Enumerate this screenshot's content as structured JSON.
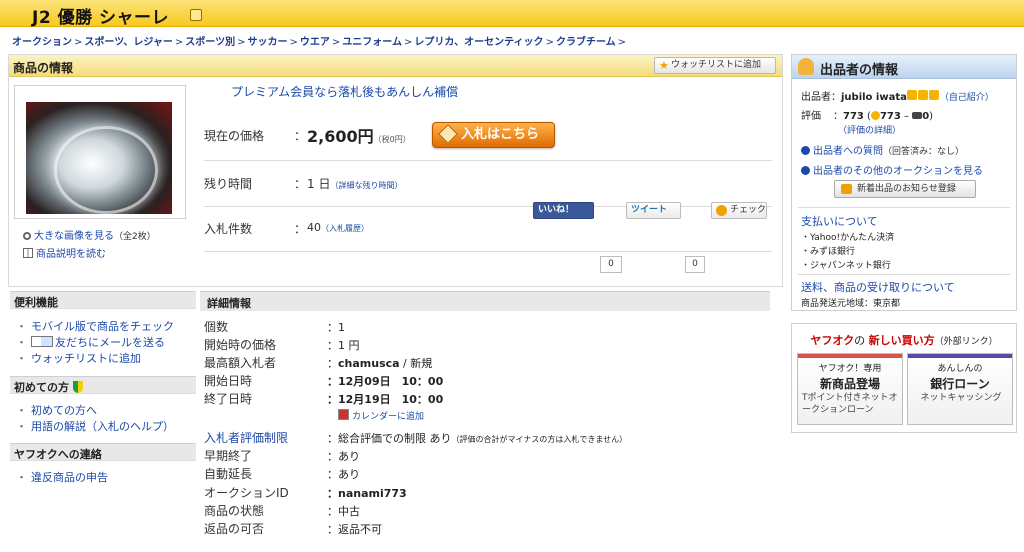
{
  "title_bar": {
    "title": "J2 優勝 シャーレ"
  },
  "breadcrumb": [
    "オークション",
    "スポーツ、レジャー",
    "スポーツ別",
    "サッカー",
    "ウエア",
    "ユニフォーム",
    "レプリカ、オーセンティック",
    "クラブチーム"
  ],
  "breadcrumb_sep": ">",
  "item": {
    "header_title": "商品の情報",
    "watchlist_label": "ウォッチリストに追加",
    "premium_text": "プレミアム会員なら落札後もあんしん補償",
    "price_label": "現在の価格",
    "price_value": "2,600円",
    "price_tax": "（税0円）",
    "bid_button": "入札はこちら",
    "time_label": "残り時間",
    "time_value": "1 日",
    "time_detail": "（詳細な残り時間）",
    "bids_label": "入札件数",
    "bids_value": "40",
    "bids_history": "（入札履歴）",
    "enlarge_link": "大きな画像を見る",
    "enlarge_count": "（全2枚）",
    "description_link": "商品説明を読む",
    "colon": "："
  },
  "social": {
    "like_label": "いいね！",
    "like_count": "0",
    "tweet_label": "ツイート",
    "tweet_count": "0",
    "check_label": "チェック"
  },
  "sidebar": {
    "convenience_title": "便利機能",
    "convenience_items": [
      "モバイル版で商品をチェック",
      "友だちにメールを送る",
      "ウォッチリストに追加"
    ],
    "beginner_title": "初めての方",
    "beginner_items": [
      "初めての方へ",
      "用語の解説（入札のヘルプ）"
    ],
    "contact_title": "ヤフオクへの連絡",
    "contact_items": [
      "違反商品の申告"
    ],
    "bullet": "・"
  },
  "detail": {
    "title": "詳細情報",
    "quantity_label": "個数",
    "quantity_value": "1",
    "start_price_label": "開始時の価格",
    "start_price_value": "1 円",
    "top_bidder_label": "最高額入札者",
    "top_bidder_name": "chamusca",
    "top_bidder_status": " / 新規",
    "start_label": "開始日時",
    "start_value": "12月09日　10：00",
    "end_label": "終了日時",
    "end_value": "12月19日　10：00",
    "calendar_link": "カレンダーに追加",
    "restriction_label": "入札者評価制限",
    "restriction_value": "総合評価での制限 あり",
    "restriction_note": "（評価の合計がマイナスの方は入札できません）",
    "early_end_label": "早期終了",
    "early_end_value": "あり",
    "auto_extend_label": "自動延長",
    "auto_extend_value": "あり",
    "auction_id_label": "オークションID",
    "auction_id_value": "nanami773",
    "condition_label": "商品の状態",
    "condition_value": "中古",
    "returns_label": "返品の可否",
    "returns_value": "返品不可"
  },
  "seller": {
    "title": "出品者の情報",
    "seller_label": "出品者",
    "seller_name": "jubilo iwata",
    "self_intro": "（自己紹介）",
    "rating_label": "評価",
    "rating_value": "773",
    "rating_good": "773",
    "rating_bad": "0",
    "rating_detail": "（評価の詳細）",
    "question_link": "出品者への質問",
    "question_note": "（回答済み：なし）",
    "other_auctions_link": "出品者のその他のオークションを見る",
    "notify_button": "新着出品のお知らせ登録",
    "payment_title": "支払いについて",
    "payment_methods": [
      "Yahoo!かんたん決済",
      "みずほ銀行",
      "ジャパンネット銀行"
    ],
    "shipping_title": "送料、商品の受け取りについて",
    "shipping_origin": "商品発送元地域：東京都"
  },
  "promo": {
    "title_brand": "ヤフオク",
    "title_mid": "の ",
    "title_new": "新しい買い方",
    "title_note": "（外部リンク）",
    "cards": [
      {
        "l1": "ヤフオク！専用",
        "l2": "新商品登場",
        "l3": "Tポイント付きネットオークションローン",
        "color": "#d9534f"
      },
      {
        "l1": "あんしんの",
        "l2": "銀行ローン",
        "l3": "ネットキャッシング",
        "color": "#5a4aa6"
      }
    ]
  },
  "colors": {
    "title_bar": "#f7c81e",
    "link": "#1b49a8",
    "bid_button": "#e06c00",
    "seller_header": "#bcd3ec"
  }
}
